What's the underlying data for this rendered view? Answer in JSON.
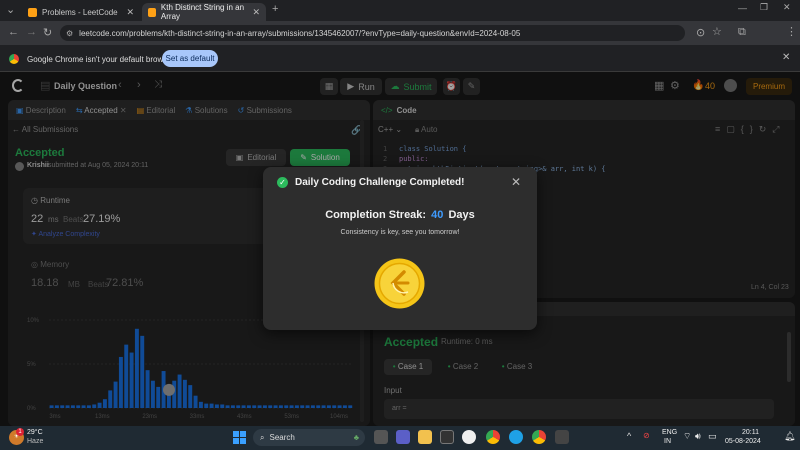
{
  "browser": {
    "tabs": [
      {
        "title": "Problems - LeetCode",
        "active": false
      },
      {
        "title": "Kth Distinct String in an Array",
        "active": true
      }
    ],
    "url": "leetcode.com/problems/kth-distinct-string-in-an-array/submissions/1345462007/?envType=daily-question&envId=2024-08-05",
    "infobar_text": "Google Chrome isn't your default browser",
    "infobar_button": "Set as default",
    "profile_initial": "K"
  },
  "header": {
    "title": "Daily Question",
    "run": "Run",
    "submit": "Submit",
    "streak": "40",
    "premium": "Premium"
  },
  "left_panel": {
    "tabs": [
      "Description",
      "Accepted",
      "Editorial",
      "Solutions",
      "Submissions"
    ],
    "back_label": "All Submissions",
    "status": "Accepted",
    "user": "Krishii",
    "submitted_text": "submitted at Aug 05, 2024 20:11",
    "editorial_btn": "Editorial",
    "solution_btn": "Solution",
    "runtime_label": "Runtime",
    "runtime_value": "22",
    "runtime_unit": "ms",
    "beats_label": "Beats",
    "runtime_beats": "27.19%",
    "analyze": "Analyze Complexity",
    "memory_label": "Memory",
    "memory_value": "18.18",
    "memory_unit": "MB",
    "memory_beats": "72.81%",
    "chart_yticks": [
      "10%",
      "5%",
      "0%"
    ],
    "chart_xticks": [
      "3ms",
      "13ms",
      "23ms",
      "33ms",
      "43ms",
      "53ms",
      "104ms"
    ]
  },
  "code_panel": {
    "title": "Code",
    "language": "C++",
    "mode": "Auto",
    "lines": [
      {
        "n": "1",
        "text": "class Solution {"
      },
      {
        "n": "2",
        "text": "public:"
      },
      {
        "n": "3",
        "text": "    string kthDistinct(vector<string>& arr, int k) {"
      }
    ],
    "cursor_pos": "Ln 4, Col 23"
  },
  "result_panel": {
    "status": "Accepted",
    "runtime": "Runtime: 0 ms",
    "cases": [
      "Case 1",
      "Case 2",
      "Case 3"
    ],
    "input_label": "Input",
    "input_var": "arr ="
  },
  "modal": {
    "title": "Daily Coding Challenge Completed!",
    "streak_prefix": "Completion Streak:",
    "streak_value": "40",
    "streak_suffix": "Days",
    "message": "Consistency is key, see you tomorrow!"
  },
  "taskbar": {
    "temp": "29°C",
    "weather": "Haze",
    "search": "Search",
    "lang1": "ENG",
    "lang2": "IN",
    "time": "20:11",
    "date": "05-08-2024",
    "weather_badge": "1"
  },
  "chart_data": {
    "type": "bar",
    "categories": [
      "3ms",
      "13ms",
      "23ms",
      "33ms",
      "43ms",
      "53ms",
      "104ms"
    ],
    "values": [
      0.3,
      0.3,
      0.3,
      0.3,
      0.3,
      0.3,
      0.3,
      0.3,
      0.4,
      0.6,
      1,
      2,
      3,
      5.8,
      7.2,
      6.3,
      9,
      8.2,
      4.3,
      3.1,
      2.4,
      4.2,
      1.6,
      3.1,
      3.8,
      3.2,
      2.6,
      1.4,
      0.7,
      0.5,
      0.5,
      0.4,
      0.4,
      0.3,
      0.3,
      0.3,
      0.3,
      0.3,
      0.3,
      0.3,
      0.3,
      0.3,
      0.3,
      0.3,
      0.3,
      0.3,
      0.3,
      0.3,
      0.3,
      0.3,
      0.3,
      0.3,
      0.3,
      0.3,
      0.3,
      0.3,
      0.3
    ],
    "ylim": [
      0,
      10
    ],
    "highlight_index": 22
  },
  "colors": {
    "accent_green": "#2cbb5d",
    "brand_orange": "#ffa116",
    "chart_blue": "#1a73e8",
    "modal_streak": "#3f9cff"
  }
}
